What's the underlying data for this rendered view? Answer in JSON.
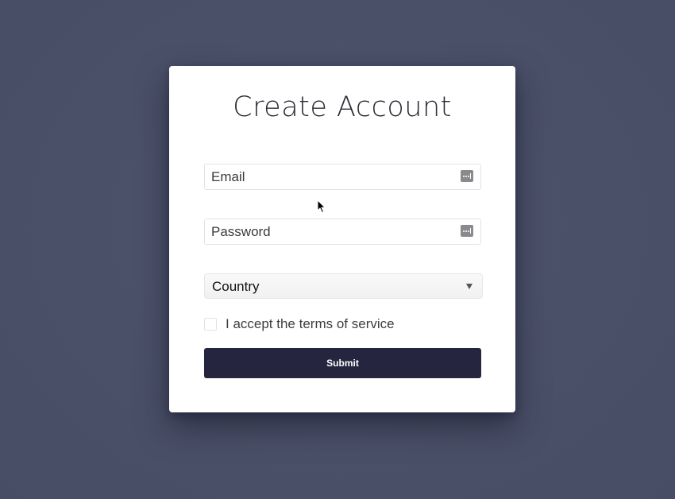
{
  "form": {
    "title": "Create Account",
    "email": {
      "placeholder": "Email",
      "value": "",
      "icon": "password-manager-key-icon"
    },
    "password": {
      "placeholder": "Password",
      "value": "",
      "icon": "password-manager-key-icon"
    },
    "country": {
      "selected": "Country",
      "icon": "caret-down-icon"
    },
    "terms": {
      "label": "I accept the terms of service",
      "checked": false
    },
    "submit_label": "Submit"
  },
  "colors": {
    "background": "#4a5068",
    "card": "#ffffff",
    "button": "#252540",
    "button_text": "#ffffff"
  }
}
